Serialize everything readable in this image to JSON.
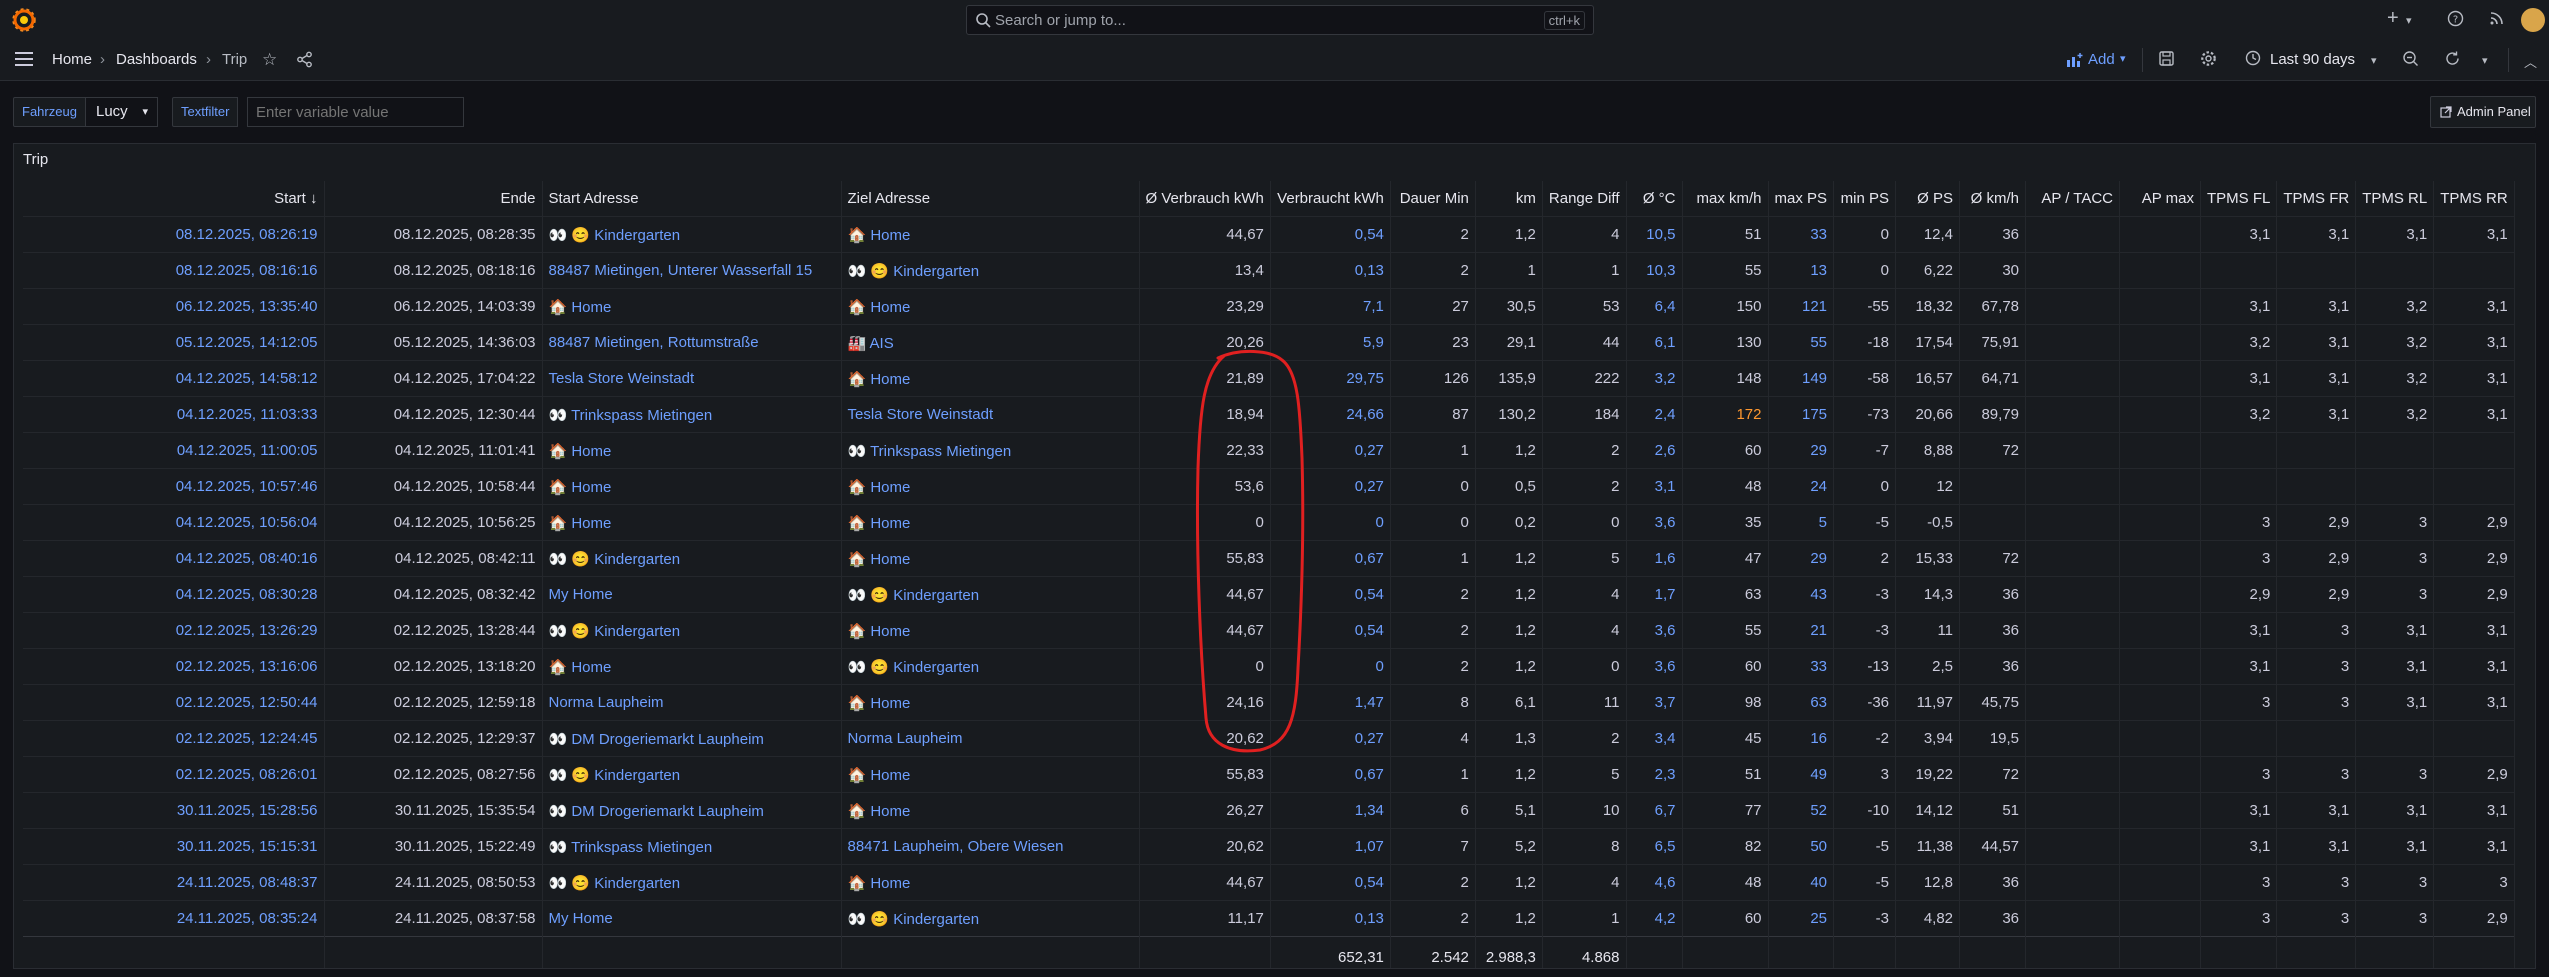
{
  "topbar": {
    "search_placeholder": "Search or jump to...",
    "search_shortcut": "ctrl+k",
    "plus_label": "+"
  },
  "nav": {
    "breadcrumbs": [
      "Home",
      "Dashboards",
      "Trip"
    ],
    "add_label": "Add",
    "time_range": "Last 90 days"
  },
  "variables": {
    "vehicle_label": "Fahrzeug",
    "vehicle_value": "Lucy",
    "textfilter_label": "Textfilter",
    "textfilter_placeholder": "Enter variable value"
  },
  "admin_panel_label": "Admin Panel",
  "panel": {
    "title": "Trip",
    "columns": [
      "Start",
      "Ende",
      "Start Adresse",
      "Ziel Adresse",
      "Ø Verbrauch kWh",
      "Verbraucht kWh",
      "Dauer Min",
      "km",
      "Range Diff",
      "Ø °C",
      "max km/h",
      "max PS",
      "min PS",
      "Ø PS",
      "Ø km/h",
      "AP / TACC",
      "AP max",
      "TPMS FL",
      "TPMS FR",
      "TPMS RL",
      "TPMS RR"
    ],
    "rows": [
      [
        "08.12.2025, 08:26:19",
        "08.12.2025, 08:28:35",
        "👀 😊 Kindergarten",
        "🏠 Home",
        "44,67",
        "0,54",
        "2",
        "1,2",
        "4",
        "10,5",
        "51",
        "33",
        "0",
        "12,4",
        "36",
        "",
        "",
        "3,1",
        "3,1",
        "3,1",
        "3,1"
      ],
      [
        "08.12.2025, 08:16:16",
        "08.12.2025, 08:18:16",
        "88487 Mietingen, Unterer Wasserfall 15",
        "👀 😊 Kindergarten",
        "13,4",
        "0,13",
        "2",
        "1",
        "1",
        "10,3",
        "55",
        "13",
        "0",
        "6,22",
        "30",
        "",
        "",
        "",
        "",
        "",
        ""
      ],
      [
        "06.12.2025, 13:35:40",
        "06.12.2025, 14:03:39",
        "🏠 Home",
        "🏠 Home",
        "23,29",
        "7,1",
        "27",
        "30,5",
        "53",
        "6,4",
        "150",
        "121",
        "-55",
        "18,32",
        "67,78",
        "",
        "",
        "3,1",
        "3,1",
        "3,2",
        "3,1"
      ],
      [
        "05.12.2025, 14:12:05",
        "05.12.2025, 14:36:03",
        "88487 Mietingen, Rottumstraße",
        "🏭 AIS",
        "20,26",
        "5,9",
        "23",
        "29,1",
        "44",
        "6,1",
        "130",
        "55",
        "-18",
        "17,54",
        "75,91",
        "",
        "",
        "3,2",
        "3,1",
        "3,2",
        "3,1"
      ],
      [
        "04.12.2025, 14:58:12",
        "04.12.2025, 17:04:22",
        "Tesla Store Weinstadt",
        "🏠 Home",
        "21,89",
        "29,75",
        "126",
        "135,9",
        "222",
        "3,2",
        "148",
        "149",
        "-58",
        "16,57",
        "64,71",
        "",
        "",
        "3,1",
        "3,1",
        "3,2",
        "3,1"
      ],
      [
        "04.12.2025, 11:03:33",
        "04.12.2025, 12:30:44",
        "👀 Trinkspass Mietingen",
        "Tesla Store Weinstadt",
        "18,94",
        "24,66",
        "87",
        "130,2",
        "184",
        "2,4",
        "172",
        "175",
        "-73",
        "20,66",
        "89,79",
        "",
        "",
        "3,2",
        "3,1",
        "3,2",
        "3,1"
      ],
      [
        "04.12.2025, 11:00:05",
        "04.12.2025, 11:01:41",
        "🏠 Home",
        "👀 Trinkspass Mietingen",
        "22,33",
        "0,27",
        "1",
        "1,2",
        "2",
        "2,6",
        "60",
        "29",
        "-7",
        "8,88",
        "72",
        "",
        "",
        "",
        "",
        "",
        ""
      ],
      [
        "04.12.2025, 10:57:46",
        "04.12.2025, 10:58:44",
        "🏠 Home",
        "🏠 Home",
        "53,6",
        "0,27",
        "0",
        "0,5",
        "2",
        "3,1",
        "48",
        "24",
        "0",
        "12",
        "",
        "",
        "",
        "",
        "",
        "",
        ""
      ],
      [
        "04.12.2025, 10:56:04",
        "04.12.2025, 10:56:25",
        "🏠 Home",
        "🏠 Home",
        "0",
        "0",
        "0",
        "0,2",
        "0",
        "3,6",
        "35",
        "5",
        "-5",
        "-0,5",
        "",
        "",
        "",
        "3",
        "2,9",
        "3",
        "2,9"
      ],
      [
        "04.12.2025, 08:40:16",
        "04.12.2025, 08:42:11",
        "👀 😊 Kindergarten",
        "🏠 Home",
        "55,83",
        "0,67",
        "1",
        "1,2",
        "5",
        "1,6",
        "47",
        "29",
        "2",
        "15,33",
        "72",
        "",
        "",
        "3",
        "2,9",
        "3",
        "2,9"
      ],
      [
        "04.12.2025, 08:30:28",
        "04.12.2025, 08:32:42",
        "My Home",
        "👀 😊 Kindergarten",
        "44,67",
        "0,54",
        "2",
        "1,2",
        "4",
        "1,7",
        "63",
        "43",
        "-3",
        "14,3",
        "36",
        "",
        "",
        "2,9",
        "2,9",
        "3",
        "2,9"
      ],
      [
        "02.12.2025, 13:26:29",
        "02.12.2025, 13:28:44",
        "👀 😊 Kindergarten",
        "🏠 Home",
        "44,67",
        "0,54",
        "2",
        "1,2",
        "4",
        "3,6",
        "55",
        "21",
        "-3",
        "11",
        "36",
        "",
        "",
        "3,1",
        "3",
        "3,1",
        "3,1"
      ],
      [
        "02.12.2025, 13:16:06",
        "02.12.2025, 13:18:20",
        "🏠 Home",
        "👀 😊 Kindergarten",
        "0",
        "0",
        "2",
        "1,2",
        "0",
        "3,6",
        "60",
        "33",
        "-13",
        "2,5",
        "36",
        "",
        "",
        "3,1",
        "3",
        "3,1",
        "3,1"
      ],
      [
        "02.12.2025, 12:50:44",
        "02.12.2025, 12:59:18",
        "Norma Laupheim",
        "🏠 Home",
        "24,16",
        "1,47",
        "8",
        "6,1",
        "11",
        "3,7",
        "98",
        "63",
        "-36",
        "11,97",
        "45,75",
        "",
        "",
        "3",
        "3",
        "3,1",
        "3,1"
      ],
      [
        "02.12.2025, 12:24:45",
        "02.12.2025, 12:29:37",
        "👀 DM Drogeriemarkt Laupheim",
        "Norma Laupheim",
        "20,62",
        "0,27",
        "4",
        "1,3",
        "2",
        "3,4",
        "45",
        "16",
        "-2",
        "3,94",
        "19,5",
        "",
        "",
        "",
        "",
        "",
        ""
      ],
      [
        "02.12.2025, 08:26:01",
        "02.12.2025, 08:27:56",
        "👀 😊 Kindergarten",
        "🏠 Home",
        "55,83",
        "0,67",
        "1",
        "1,2",
        "5",
        "2,3",
        "51",
        "49",
        "3",
        "19,22",
        "72",
        "",
        "",
        "3",
        "3",
        "3",
        "2,9"
      ],
      [
        "30.11.2025, 15:28:56",
        "30.11.2025, 15:35:54",
        "👀 DM Drogeriemarkt Laupheim",
        "🏠 Home",
        "26,27",
        "1,34",
        "6",
        "5,1",
        "10",
        "6,7",
        "77",
        "52",
        "-10",
        "14,12",
        "51",
        "",
        "",
        "3,1",
        "3,1",
        "3,1",
        "3,1"
      ],
      [
        "30.11.2025, 15:15:31",
        "30.11.2025, 15:22:49",
        "👀 Trinkspass Mietingen",
        "88471 Laupheim, Obere Wiesen",
        "20,62",
        "1,07",
        "7",
        "5,2",
        "8",
        "6,5",
        "82",
        "50",
        "-5",
        "11,38",
        "44,57",
        "",
        "",
        "3,1",
        "3,1",
        "3,1",
        "3,1"
      ],
      [
        "24.11.2025, 08:48:37",
        "24.11.2025, 08:50:53",
        "👀 😊 Kindergarten",
        "🏠 Home",
        "44,67",
        "0,54",
        "2",
        "1,2",
        "4",
        "4,6",
        "48",
        "40",
        "-5",
        "12,8",
        "36",
        "",
        "",
        "3",
        "3",
        "3",
        "3"
      ],
      [
        "24.11.2025, 08:35:24",
        "24.11.2025, 08:37:58",
        "My Home",
        "👀 😊 Kindergarten",
        "11,17",
        "0,13",
        "2",
        "1,2",
        "1",
        "4,2",
        "60",
        "25",
        "-3",
        "4,82",
        "36",
        "",
        "",
        "3",
        "3",
        "3",
        "2,9"
      ]
    ],
    "footer": [
      "",
      "",
      "",
      "",
      "",
      "652,31",
      "2.542",
      "2.988,3",
      "4.868",
      "",
      "",
      "",
      "",
      "",
      "",
      "",
      "",
      "",
      "",
      "",
      ""
    ]
  },
  "colors": {
    "link": "#6e9fff",
    "highlight": "#ff9830",
    "annotation": "#e02020"
  }
}
